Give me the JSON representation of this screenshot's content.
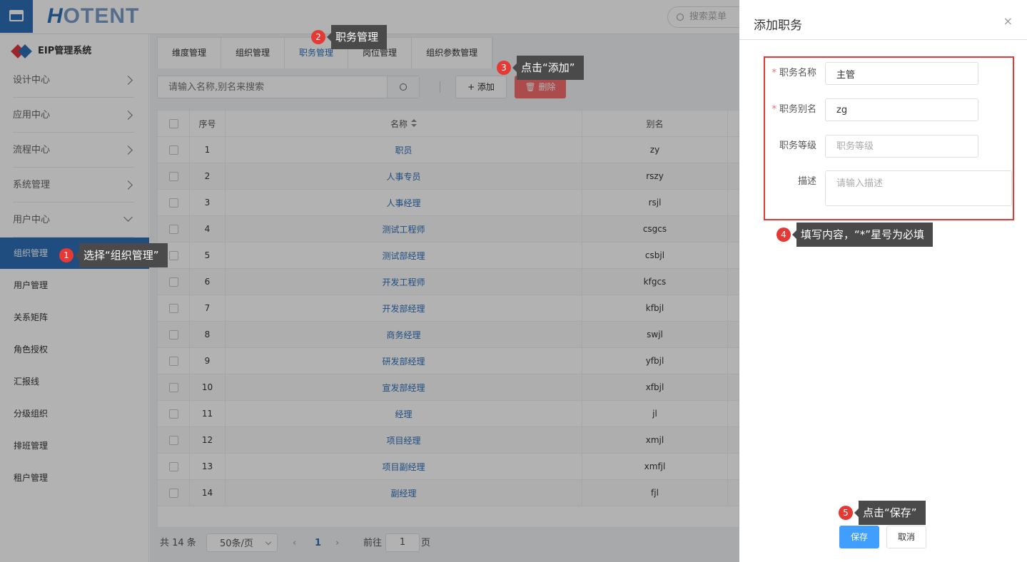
{
  "header": {
    "logo_h": "H",
    "logo_rest": "OTENT",
    "search_placeholder": "搜索菜单"
  },
  "sidebar": {
    "brand": "EIP管理系统",
    "groups": [
      {
        "label": "设计中心"
      },
      {
        "label": "应用中心"
      },
      {
        "label": "流程中心"
      },
      {
        "label": "系统管理"
      },
      {
        "label": "用户中心"
      }
    ],
    "items": [
      {
        "label": "组织管理"
      },
      {
        "label": "用户管理"
      },
      {
        "label": "关系矩阵"
      },
      {
        "label": "角色授权"
      },
      {
        "label": "汇报线"
      },
      {
        "label": "分级组织"
      },
      {
        "label": "排班管理"
      },
      {
        "label": "租户管理"
      }
    ]
  },
  "tabs": [
    {
      "label": "维度管理"
    },
    {
      "label": "组织管理"
    },
    {
      "label": "职务管理"
    },
    {
      "label": "岗位管理"
    },
    {
      "label": "组织参数管理"
    }
  ],
  "toolbar": {
    "search_placeholder": "请输入名称,别名来搜索",
    "add_label": "+ 添加",
    "delete_label": "删除"
  },
  "table": {
    "headers": {
      "no": "序号",
      "name": "名称",
      "alias": "别名"
    },
    "rows": [
      {
        "no": "1",
        "name": "职员",
        "alias": "zy"
      },
      {
        "no": "2",
        "name": "人事专员",
        "alias": "rszy"
      },
      {
        "no": "3",
        "name": "人事经理",
        "alias": "rsjl"
      },
      {
        "no": "4",
        "name": "测试工程师",
        "alias": "csgcs"
      },
      {
        "no": "5",
        "name": "测试部经理",
        "alias": "csbjl"
      },
      {
        "no": "6",
        "name": "开发工程师",
        "alias": "kfgcs"
      },
      {
        "no": "7",
        "name": "开发部经理",
        "alias": "kfbjl"
      },
      {
        "no": "8",
        "name": "商务经理",
        "alias": "swjl"
      },
      {
        "no": "9",
        "name": "研发部经理",
        "alias": "yfbjl"
      },
      {
        "no": "10",
        "name": "宣发部经理",
        "alias": "xfbjl"
      },
      {
        "no": "11",
        "name": "经理",
        "alias": "jl"
      },
      {
        "no": "12",
        "name": "项目经理",
        "alias": "xmjl"
      },
      {
        "no": "13",
        "name": "项目副经理",
        "alias": "xmfjl"
      },
      {
        "no": "14",
        "name": "副经理",
        "alias": "fjl"
      }
    ]
  },
  "pager": {
    "total": "共 14 条",
    "page_size": "50条/页",
    "current_page": "1",
    "goto_label": "前往",
    "goto_value": "1",
    "page_unit": "页"
  },
  "drawer": {
    "title": "添加职务",
    "close": "×",
    "fields": {
      "name_label": "职务名称",
      "name_value": "主管",
      "alias_label": "职务别名",
      "alias_value": "zg",
      "level_label": "职务等级",
      "level_placeholder": "职务等级",
      "desc_label": "描述",
      "desc_placeholder": "请输入描述"
    },
    "save_label": "保存",
    "cancel_label": "取消"
  },
  "callouts": [
    {
      "num": "1",
      "text": "选择“组织管理”"
    },
    {
      "num": "2",
      "text": "职务管理"
    },
    {
      "num": "3",
      "text": "点击“添加”"
    },
    {
      "num": "4",
      "text": "填写内容，“*”星号为必填"
    },
    {
      "num": "5",
      "text": "点击“保存”"
    }
  ],
  "colors": {
    "primary": "#2d6fb8",
    "danger": "#f56c6c",
    "save": "#409eff",
    "annotation_red": "#e53935"
  }
}
